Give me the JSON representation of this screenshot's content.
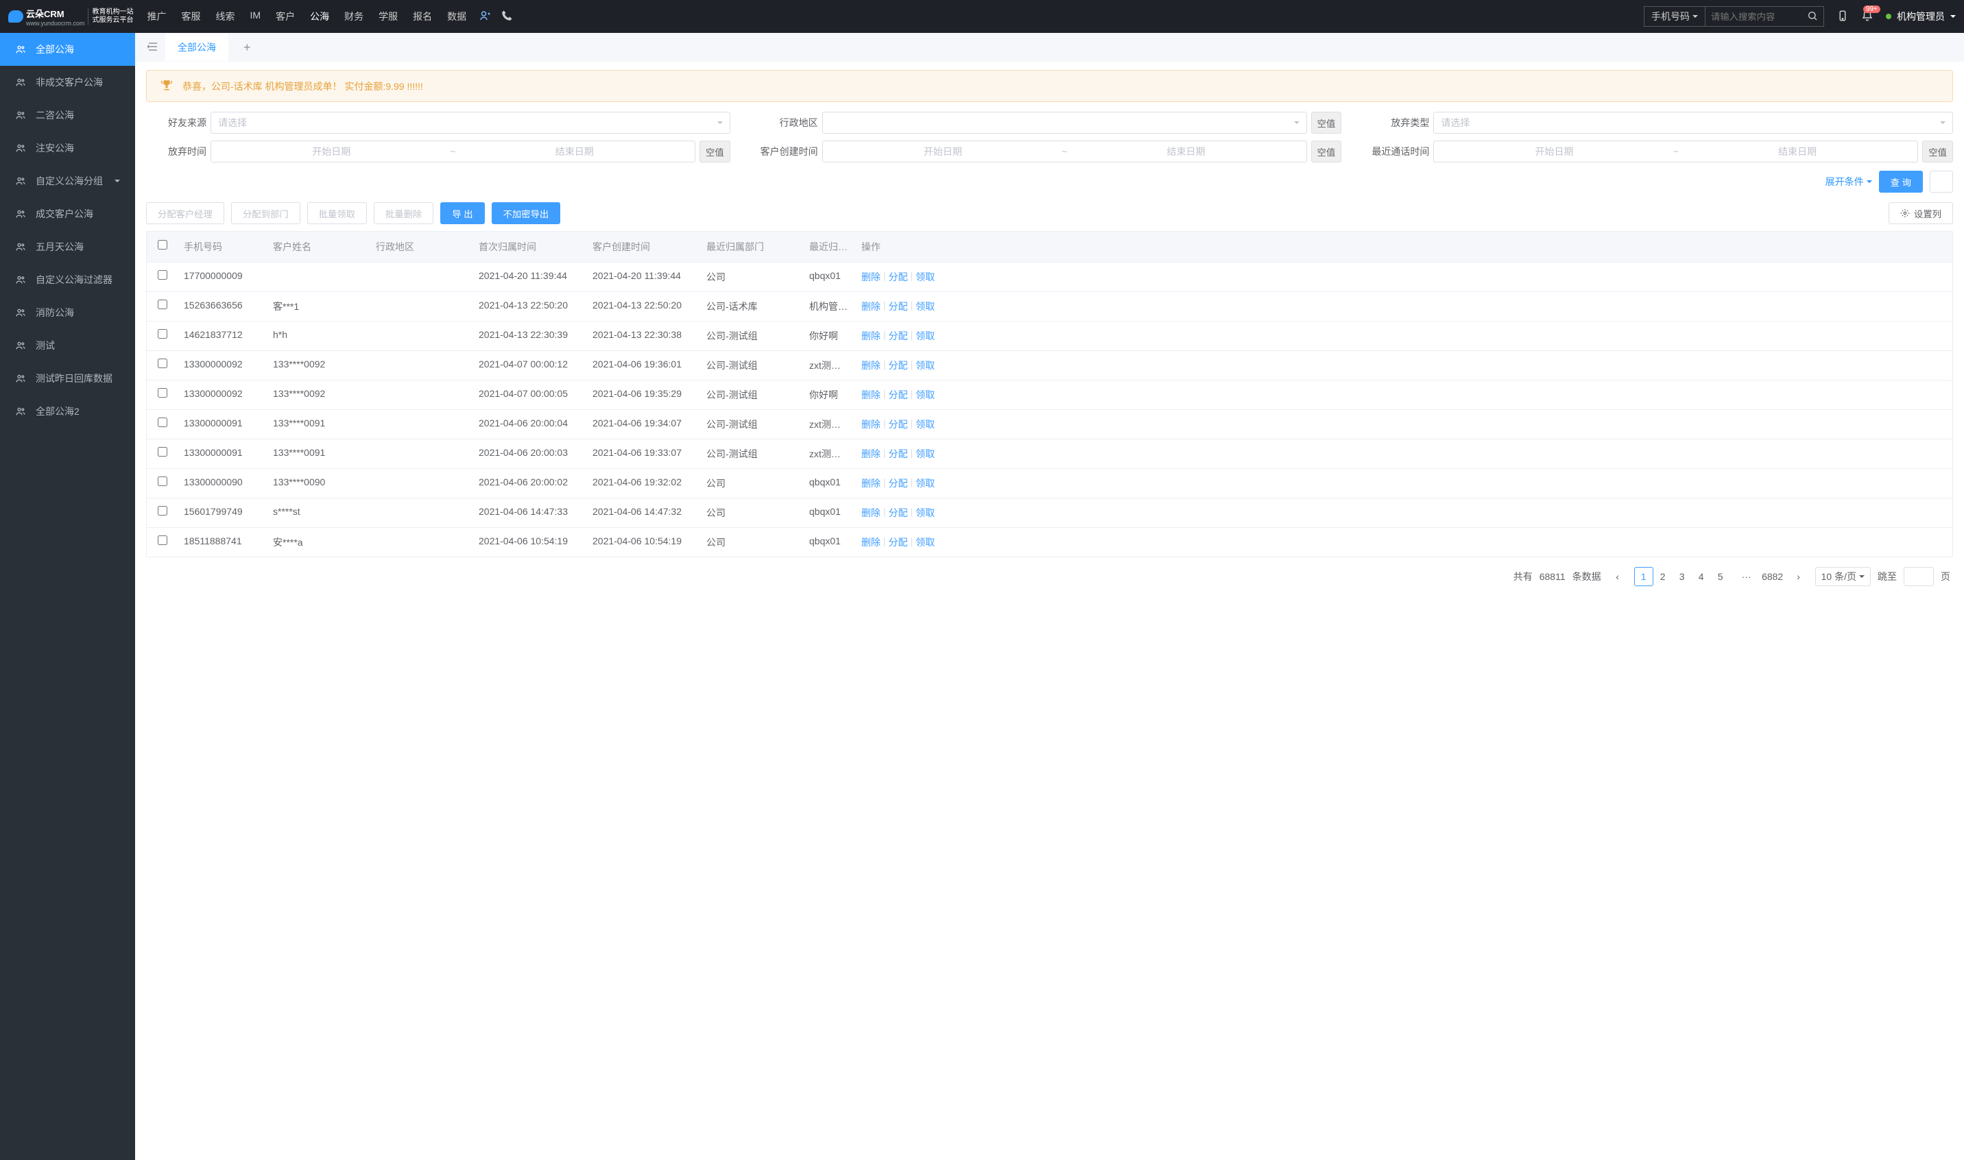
{
  "top": {
    "logo_main": "云朵CRM",
    "logo_url": "www.yunduocrm.com",
    "logo_sub1": "教育机构一站",
    "logo_sub2": "式服务云平台",
    "nav": [
      "推广",
      "客服",
      "线索",
      "IM",
      "客户",
      "公海",
      "财务",
      "学服",
      "报名",
      "数据"
    ],
    "nav_active": 5,
    "search_type": "手机号码",
    "search_placeholder": "请输入搜索内容",
    "badge": "99+",
    "user": "机构管理员"
  },
  "sidebar": [
    "全部公海",
    "非成交客户公海",
    "二咨公海",
    "注安公海",
    "自定义公海分组",
    "成交客户公海",
    "五月天公海",
    "自定义公海过滤器",
    "消防公海",
    "测试",
    "测试昨日回库数据",
    "全部公海2"
  ],
  "sidebar_active": 0,
  "tabs": {
    "active_label": "全部公海"
  },
  "banner": "恭喜，公司-话术库  机构管理员成单！ 实付金额:9.99 !!!!!!",
  "filters": {
    "friend_source": "好友来源",
    "friend_source_ph": "请选择",
    "region_label": "行政地区",
    "abandon_type": "放弃类型",
    "abandon_type_ph": "请选择",
    "abandon_time": "放弃时间",
    "create_time": "客户创建时间",
    "call_time": "最近通话时间",
    "start_ph": "开始日期",
    "end_ph": "结束日期",
    "null_btn": "空值",
    "expand": "展开条件",
    "query": "查 询"
  },
  "actions": {
    "assign_manager": "分配客户经理",
    "assign_dept": "分配到部门",
    "batch_claim": "批量领取",
    "batch_delete": "批量删除",
    "export": "导 出",
    "export_plain": "不加密导出",
    "columns": "设置列"
  },
  "columns": [
    "手机号码",
    "客户姓名",
    "行政地区",
    "首次归属时间",
    "客户创建时间",
    "最近归属部门",
    "最近归属人",
    "操作"
  ],
  "rows": [
    {
      "phone": "17700000009",
      "name": "",
      "region": "",
      "first": "2021-04-20 11:39:44",
      "created": "2021-04-20 11:39:44",
      "dept": "公司",
      "owner": "qbqx01"
    },
    {
      "phone": "15263663656",
      "name": "客***1",
      "region": "",
      "first": "2021-04-13 22:50:20",
      "created": "2021-04-13 22:50:20",
      "dept": "公司-话术库",
      "owner": "机构管理员"
    },
    {
      "phone": "14621837712",
      "name": "h*h",
      "region": "",
      "first": "2021-04-13 22:30:39",
      "created": "2021-04-13 22:30:38",
      "dept": "公司-测试组",
      "owner": "你好啊"
    },
    {
      "phone": "13300000092",
      "name": "133****0092",
      "region": "",
      "first": "2021-04-07 00:00:12",
      "created": "2021-04-06 19:36:01",
      "dept": "公司-测试组",
      "owner": "zxt测试导入"
    },
    {
      "phone": "13300000092",
      "name": "133****0092",
      "region": "",
      "first": "2021-04-07 00:00:05",
      "created": "2021-04-06 19:35:29",
      "dept": "公司-测试组",
      "owner": "你好啊"
    },
    {
      "phone": "13300000091",
      "name": "133****0091",
      "region": "",
      "first": "2021-04-06 20:00:04",
      "created": "2021-04-06 19:34:07",
      "dept": "公司-测试组",
      "owner": "zxt测试导入"
    },
    {
      "phone": "13300000091",
      "name": "133****0091",
      "region": "",
      "first": "2021-04-06 20:00:03",
      "created": "2021-04-06 19:33:07",
      "dept": "公司-测试组",
      "owner": "zxt测试导入"
    },
    {
      "phone": "13300000090",
      "name": "133****0090",
      "region": "",
      "first": "2021-04-06 20:00:02",
      "created": "2021-04-06 19:32:02",
      "dept": "公司",
      "owner": "qbqx01"
    },
    {
      "phone": "15601799749",
      "name": "s****st",
      "region": "",
      "first": "2021-04-06 14:47:33",
      "created": "2021-04-06 14:47:32",
      "dept": "公司",
      "owner": "qbqx01"
    },
    {
      "phone": "18511888741",
      "name": "安****a",
      "region": "",
      "first": "2021-04-06 10:54:19",
      "created": "2021-04-06 10:54:19",
      "dept": "公司",
      "owner": "qbqx01"
    }
  ],
  "row_ops": {
    "delete": "删除",
    "assign": "分配",
    "claim": "领取"
  },
  "pager": {
    "total_pre": "共有",
    "total": "68811",
    "total_post": "条数据",
    "pages": [
      "1",
      "2",
      "3",
      "4",
      "5"
    ],
    "last": "6882",
    "size": "10 条/页",
    "jump": "跳至",
    "page_suf": "页"
  }
}
